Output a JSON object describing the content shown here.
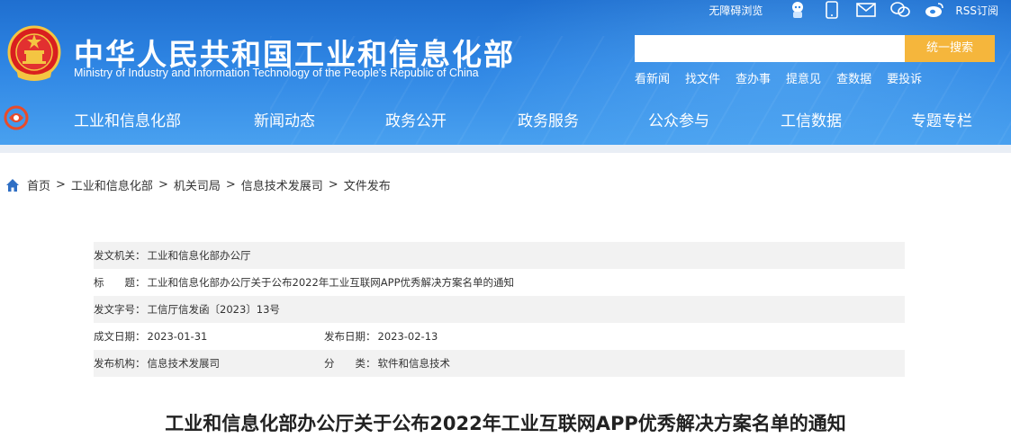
{
  "colors": {
    "header_top": "#1f6fd0",
    "header_bottom": "#4aa2f0",
    "search_button": "#f5b63c",
    "row_alt": "#f2f2f2"
  },
  "site": {
    "title_cn": "中华人民共和国工业和信息化部",
    "title_en": "Ministry of Industry and Information Technology of the People's Republic of China"
  },
  "toplinks": {
    "accessible": "无障碍浏览",
    "rss": "RSS订阅",
    "icons": [
      "robot-icon",
      "mobile-icon",
      "mail-icon",
      "wechat-icon",
      "weibo-icon"
    ]
  },
  "search": {
    "placeholder": "",
    "button_label": "统一搜索"
  },
  "quick_links": [
    "看新闻",
    "找文件",
    "查办事",
    "提意见",
    "查数据",
    "要投诉"
  ],
  "nav": [
    "工业和信息化部",
    "新闻动态",
    "政务公开",
    "政务服务",
    "公众参与",
    "工信数据",
    "专题专栏"
  ],
  "breadcrumb": [
    "首页",
    "工业和信息化部",
    "机关司局",
    "信息技术发展司",
    "文件发布"
  ],
  "info": {
    "issuer_label": "发文机关：",
    "issuer": "工业和信息化部办公厅",
    "title_label": "标　　题：",
    "title": "工业和信息化部办公厅关于公布2022年工业互联网APP优秀解决方案名单的通知",
    "number_label": "发文字号：",
    "number": "工信厅信发函〔2023〕13号",
    "created_label": "成文日期：",
    "created": "2023-01-31",
    "published_label": "发布日期：",
    "published": "2023-02-13",
    "org_label": "发布机构：",
    "org": "信息技术发展司",
    "category_label": "分　　类：",
    "category": "软件和信息技术"
  },
  "document_title": "工业和信息化部办公厅关于公布2022年工业互联网APP优秀解决方案名单的通知"
}
